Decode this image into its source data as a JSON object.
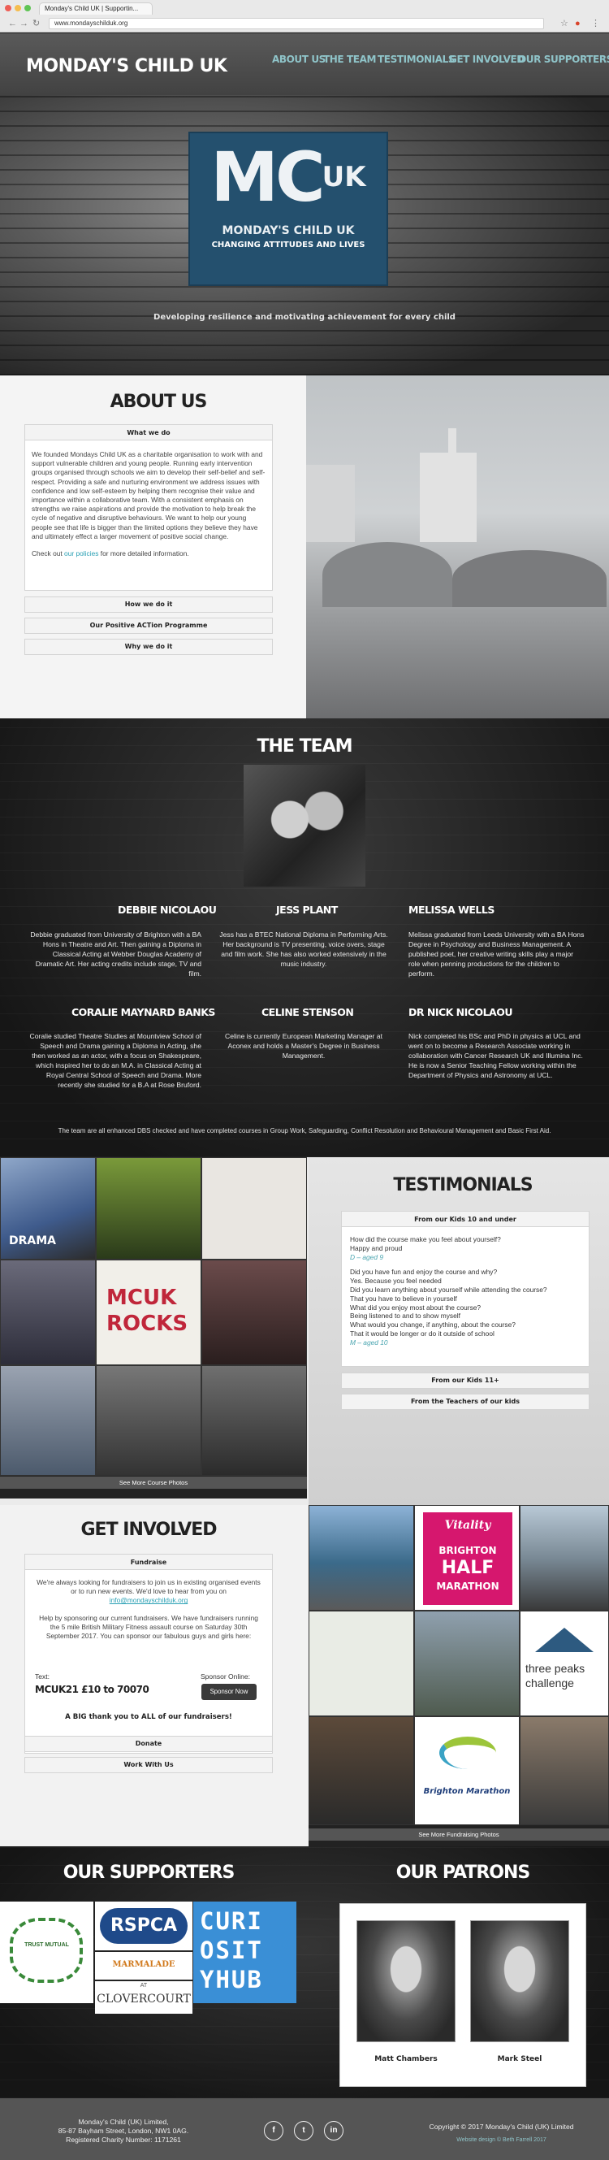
{
  "browser": {
    "tab_title": "Monday's Child UK | Supportin...",
    "url": "www.mondayschilduk.org"
  },
  "header": {
    "logo": "MONDAY'S CHILD UK",
    "nav": [
      "ABOUT US",
      "THE TEAM",
      "TESTIMONIALS",
      "GET INVOLVED",
      "OUR SUPPORTERS"
    ]
  },
  "hero": {
    "logo_letters": "MC",
    "logo_badge": "UK",
    "logo_name": "MONDAY'S CHILD UK",
    "logo_tagline": "CHANGING ATTITUDES AND LIVES",
    "subtitle": "Developing resilience and motivating achievement for every child"
  },
  "about": {
    "title": "ABOUT US",
    "panel_head": "What we do",
    "body": "We founded Mondays Child UK as a charitable organisation to work with and support vulnerable children and young people. Running early intervention groups organised through schools we aim to develop their self-belief and self-respect. Providing a safe and nurturing environment we address issues with confidence and low self-esteem by helping them recognise their value and importance within a collaborative team. With a consistent emphasis on strengths we raise aspirations and provide the motivation to help break the cycle of negative and disruptive behaviours. We want to help our young people see that life is bigger than the limited options they believe they have and ultimately effect a larger movement of positive social change.",
    "check_prefix": "Check out",
    "check_link": "our policies",
    "check_suffix": "for more detailed information.",
    "accordion": [
      "How we do it",
      "Our Positive ACTion Programme",
      "Why we do it"
    ]
  },
  "team": {
    "title": "THE TEAM",
    "members": [
      {
        "name": "DEBBIE NICOLAOU",
        "bio": "Debbie graduated from University of Brighton with a BA Hons in Theatre and Art. Then gaining a Diploma in Classical Acting at Webber Douglas Academy of Dramatic Art. Her acting credits include stage, TV and film."
      },
      {
        "name": "JESS PLANT",
        "bio": "Jess has a BTEC National Diploma in Performing Arts. Her background is TV presenting, voice overs, stage and film work. She has also worked extensively in the music industry."
      },
      {
        "name": "MELISSA WELLS",
        "bio": "Melissa graduated from Leeds University with a BA Hons Degree in Psychology and Business Management. A published poet, her creative writing skills play a major role when penning productions for the children to perform."
      },
      {
        "name": "CORALIE MAYNARD BANKS",
        "bio": "Coralie studied Theatre Studies at Mountview School of Speech and Drama gaining a Diploma in Acting, she then worked as an actor, with a focus on Shakespeare, which inspired her to do an M.A. in Classical Acting at Royal Central School of Speech and Drama. More recently she studied for a B.A at Rose Bruford."
      },
      {
        "name": "CELINE STENSON",
        "bio": "Celine is currently European Marketing Manager at Aconex and holds a Master's Degree in Business Management."
      },
      {
        "name": "DR NICK NICOLAOU",
        "bio": "Nick completed his BSc and PhD in physics at UCL and went on to become a Research Associate working in collaboration with Cancer Research UK and Illumina Inc. He is now a Senior Teaching Fellow working within the Department of Physics and Astronomy at UCL."
      }
    ],
    "note": "The team are all enhanced DBS checked and have completed courses in Group Work, Safeguarding, Conflict Resolution and Behavioural Management and Basic First Aid."
  },
  "testimonials": {
    "title": "TESTIMONIALS",
    "panel_head": "From our Kids 10 and under",
    "lines": [
      {
        "text": "How did the course make you feel about yourself?",
        "kind": "q"
      },
      {
        "text": "Happy and proud",
        "kind": "a"
      },
      {
        "text": "D – aged 9",
        "kind": "age"
      },
      {
        "text": "",
        "kind": "gap"
      },
      {
        "text": "Did you have fun and enjoy the course and why?",
        "kind": "q"
      },
      {
        "text": "Yes. Because you feel needed",
        "kind": "a"
      },
      {
        "text": "Did you learn anything about yourself while attending the course?",
        "kind": "q"
      },
      {
        "text": "That you have to believe in yourself",
        "kind": "a"
      },
      {
        "text": "What did you enjoy most about the course?",
        "kind": "q"
      },
      {
        "text": "Being listened to and to show myself",
        "kind": "a"
      },
      {
        "text": "What would you change, if anything, about the course?",
        "kind": "q"
      },
      {
        "text": "That it would be longer or do it outside of school",
        "kind": "a"
      },
      {
        "text": "M – aged 10",
        "kind": "age"
      }
    ],
    "accordion": [
      "From our Kids 11+",
      "From the Teachers of our kids"
    ],
    "photo_tile_texts": [
      "DRAMA",
      "MCUK ROCKS"
    ],
    "see_more": "See More Course Photos"
  },
  "involved": {
    "title": "GET INVOLVED",
    "panel_head": "Fundraise",
    "intro": "We're always looking for fundraisers to join us in existing organised events or to run new events. We'd love to hear from you on",
    "email": "info@mondayschilduk.org",
    "help": "Help by sponsoring our current fundraisers. We have fundraisers running the 5 mile British Military Fitness assault course on Saturday 30th September 2017. You can sponsor our fabulous guys and girls here:",
    "text_label": "Text:",
    "text_code": "MCUK21 £10 to 70070",
    "online_label": "Sponsor Online:",
    "sponsor_btn": "Sponsor Now",
    "thanks": "A BIG thank you to ALL of our fundraisers!",
    "accordion": [
      "Donate",
      "Work With Us"
    ],
    "fund_tile_texts": [
      "Vitality",
      "BRIGHTON",
      "HALF",
      "MARATHON",
      "three peaks",
      "challenge",
      "Brighton Marathon"
    ],
    "see_more": "See More Fundraising Photos"
  },
  "supporters": {
    "title": "OUR SUPPORTERS",
    "logos": [
      "RSPCA",
      "MARMALADE",
      "CLOVERCOURT",
      "CURI OSIT YHUB"
    ],
    "logo_texts": [
      "TRUST MUTUAL",
      "AT",
      "CURI",
      "OSIT",
      "YHUB"
    ]
  },
  "patrons": {
    "title": "OUR PATRONS",
    "people": [
      "Matt Chambers",
      "Mark Steel"
    ]
  },
  "footer": {
    "address": [
      "Monday's Child (UK) Limited,",
      "85-87 Bayham Street, London, NW1 0AG.",
      "Registered Charity Number: 1171261"
    ],
    "social": [
      "f",
      "t",
      "in"
    ],
    "copyright": "Copyright © 2017 Monday's Child (UK) Limited",
    "credit": "Website design © Beth Farrell 2017"
  },
  "colors": {
    "accent": "#8fc4c9",
    "link": "#2aa0b4",
    "logo_bg": "#24506e",
    "vitality_pink": "#d6176e"
  }
}
